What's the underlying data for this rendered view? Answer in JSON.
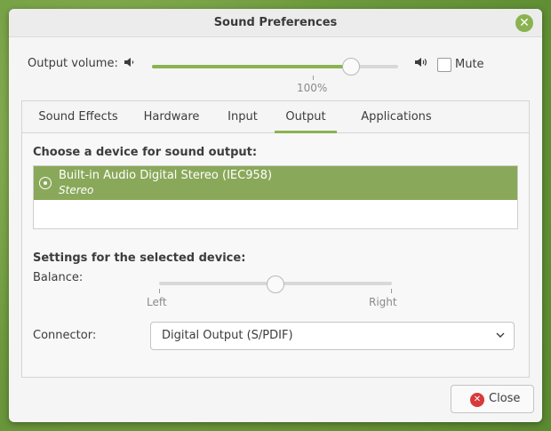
{
  "window": {
    "title": "Sound Preferences"
  },
  "output_volume": {
    "label": "Output volume:",
    "value_text": "100%",
    "value_fraction": 0.81,
    "mute_label": "Mute",
    "muted": false
  },
  "tabs": [
    {
      "label": "Sound Effects",
      "active": false
    },
    {
      "label": "Hardware",
      "active": false
    },
    {
      "label": "Input",
      "active": false
    },
    {
      "label": "Output",
      "active": true
    },
    {
      "label": "Applications",
      "active": false
    }
  ],
  "output": {
    "choose_heading": "Choose a device for sound output:",
    "devices": [
      {
        "name": "Built-in Audio Digital Stereo (IEC958)",
        "profile": "Stereo",
        "selected": true
      }
    ],
    "settings_heading": "Settings for the selected device:",
    "balance": {
      "label": "Balance:",
      "left_label": "Left",
      "right_label": "Right",
      "value_fraction": 0.5
    },
    "connector": {
      "label": "Connector:",
      "value": "Digital Output (S/PDIF)"
    }
  },
  "footer": {
    "close_label": "Close"
  },
  "colors": {
    "accent": "#8ab350",
    "selection": "#8aa85a",
    "close_icon": "#d73a3a"
  }
}
